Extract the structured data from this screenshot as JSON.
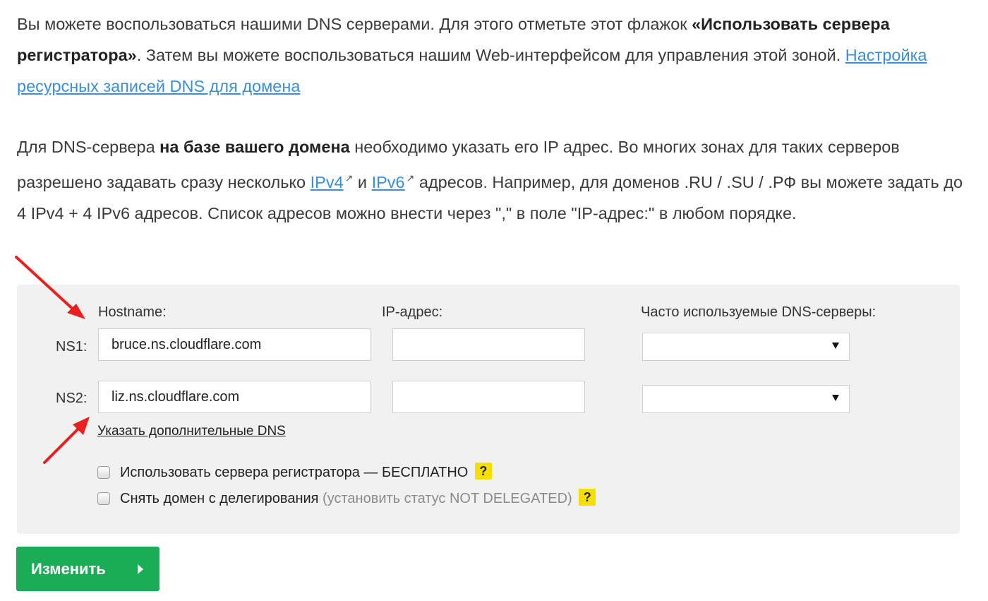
{
  "intro": {
    "text_1": "Вы можете воспользоваться нашими DNS серверами. Для этого отметьте этот флажок ",
    "bold": "«Использовать сервера регистратора»",
    "text_2": ". Затем вы можете воспользоваться нашим Web-интерфейсом для управления этой зоной. ",
    "link": "Настройка ресурсных записей DNS для домена"
  },
  "info": {
    "text_1": "Для DNS-сервера ",
    "bold": "на базе вашего домена",
    "text_2": " необходимо указать его IP адрес. Во многих зонах для таких серверов разрешено задавать сразу несколько ",
    "link_ipv4": "IPv4",
    "and": " и ",
    "link_ipv6": "IPv6",
    "text_3": " адресов. Например, для доменов .RU / .SU / .РФ вы можете задать до 4 IPv4 + 4 IPv6 адресов. Список адресов можно внести через \",\" в поле \"IP-адрес:\" в любом порядке.",
    "external_icon": "↗"
  },
  "form": {
    "col_hostname": "Hostname:",
    "col_ip": "IP-адрес:",
    "col_dns": "Часто используемые DNS-серверы:",
    "ns1_label": "NS1:",
    "ns1_hostname": "bruce.ns.cloudflare.com",
    "ns1_ip": "",
    "ns2_label": "NS2:",
    "ns2_hostname": "liz.ns.cloudflare.com",
    "ns2_ip": "",
    "more_dns_link": "Указать дополнительные DNS",
    "checkbox_registrar": "Использовать сервера регистратора — БЕСПЛАТНО",
    "checkbox_undelegate": "Снять домен с делегирования ",
    "checkbox_undelegate_note": "(установить статус NOT DELEGATED)",
    "help_mark": "?"
  },
  "submit_button": "Изменить",
  "colors": {
    "accent_green": "#1aad55",
    "link_blue": "#3a8fd6",
    "help_yellow": "#f4df00",
    "annotation_red": "#e8201f"
  },
  "icons": [
    "external-link-icon",
    "chevron-down-icon",
    "help-icon",
    "play-arrow-icon",
    "annotation-arrow"
  ]
}
